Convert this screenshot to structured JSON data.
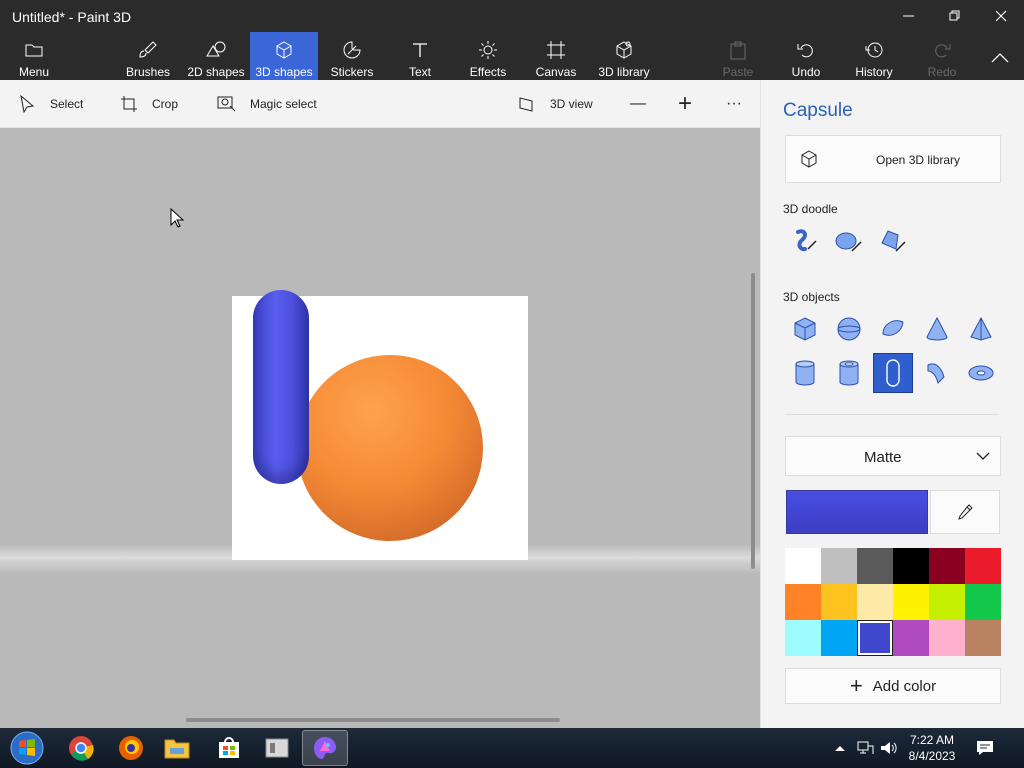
{
  "window": {
    "title": "Untitled* - Paint 3D",
    "controls": {
      "minimize": "—",
      "restore": "❐",
      "close": "✕"
    }
  },
  "ribbon": {
    "menu": "Menu",
    "items": [
      {
        "label": "Brushes"
      },
      {
        "label": "2D shapes"
      },
      {
        "label": "3D shapes"
      },
      {
        "label": "Stickers"
      },
      {
        "label": "Text"
      },
      {
        "label": "Effects"
      },
      {
        "label": "Canvas"
      },
      {
        "label": "3D library"
      }
    ],
    "right_items": [
      {
        "label": "Paste"
      },
      {
        "label": "Undo"
      },
      {
        "label": "History"
      },
      {
        "label": "Redo"
      }
    ],
    "active": "3D shapes"
  },
  "toolbar": {
    "select": "Select",
    "crop": "Crop",
    "magic_select": "Magic select",
    "view_3d": "3D view",
    "zoom_out": "—",
    "zoom_in": "+",
    "more": "···"
  },
  "panel": {
    "title": "Capsule",
    "open_library": "Open 3D library",
    "doodle_heading": "3D doodle",
    "objects_heading": "3D objects",
    "material": "Matte",
    "current_color": "#4a4ee0",
    "add_color": "Add color",
    "palette": [
      "#ffffff",
      "#c0c0c0",
      "#5a5a5a",
      "#000000",
      "#8a0020",
      "#ea1c2c",
      "#ff8226",
      "#ffc31f",
      "#fee9a8",
      "#fef200",
      "#c4f000",
      "#13c74a",
      "#9cfcfe",
      "#00a5f4",
      "#3f48cc",
      "#b04ac0",
      "#fdb1cc",
      "#b88260"
    ],
    "selected_swatch_index": 14
  },
  "taskbar": {
    "time": "7:22 AM",
    "date": "8/4/2023"
  }
}
